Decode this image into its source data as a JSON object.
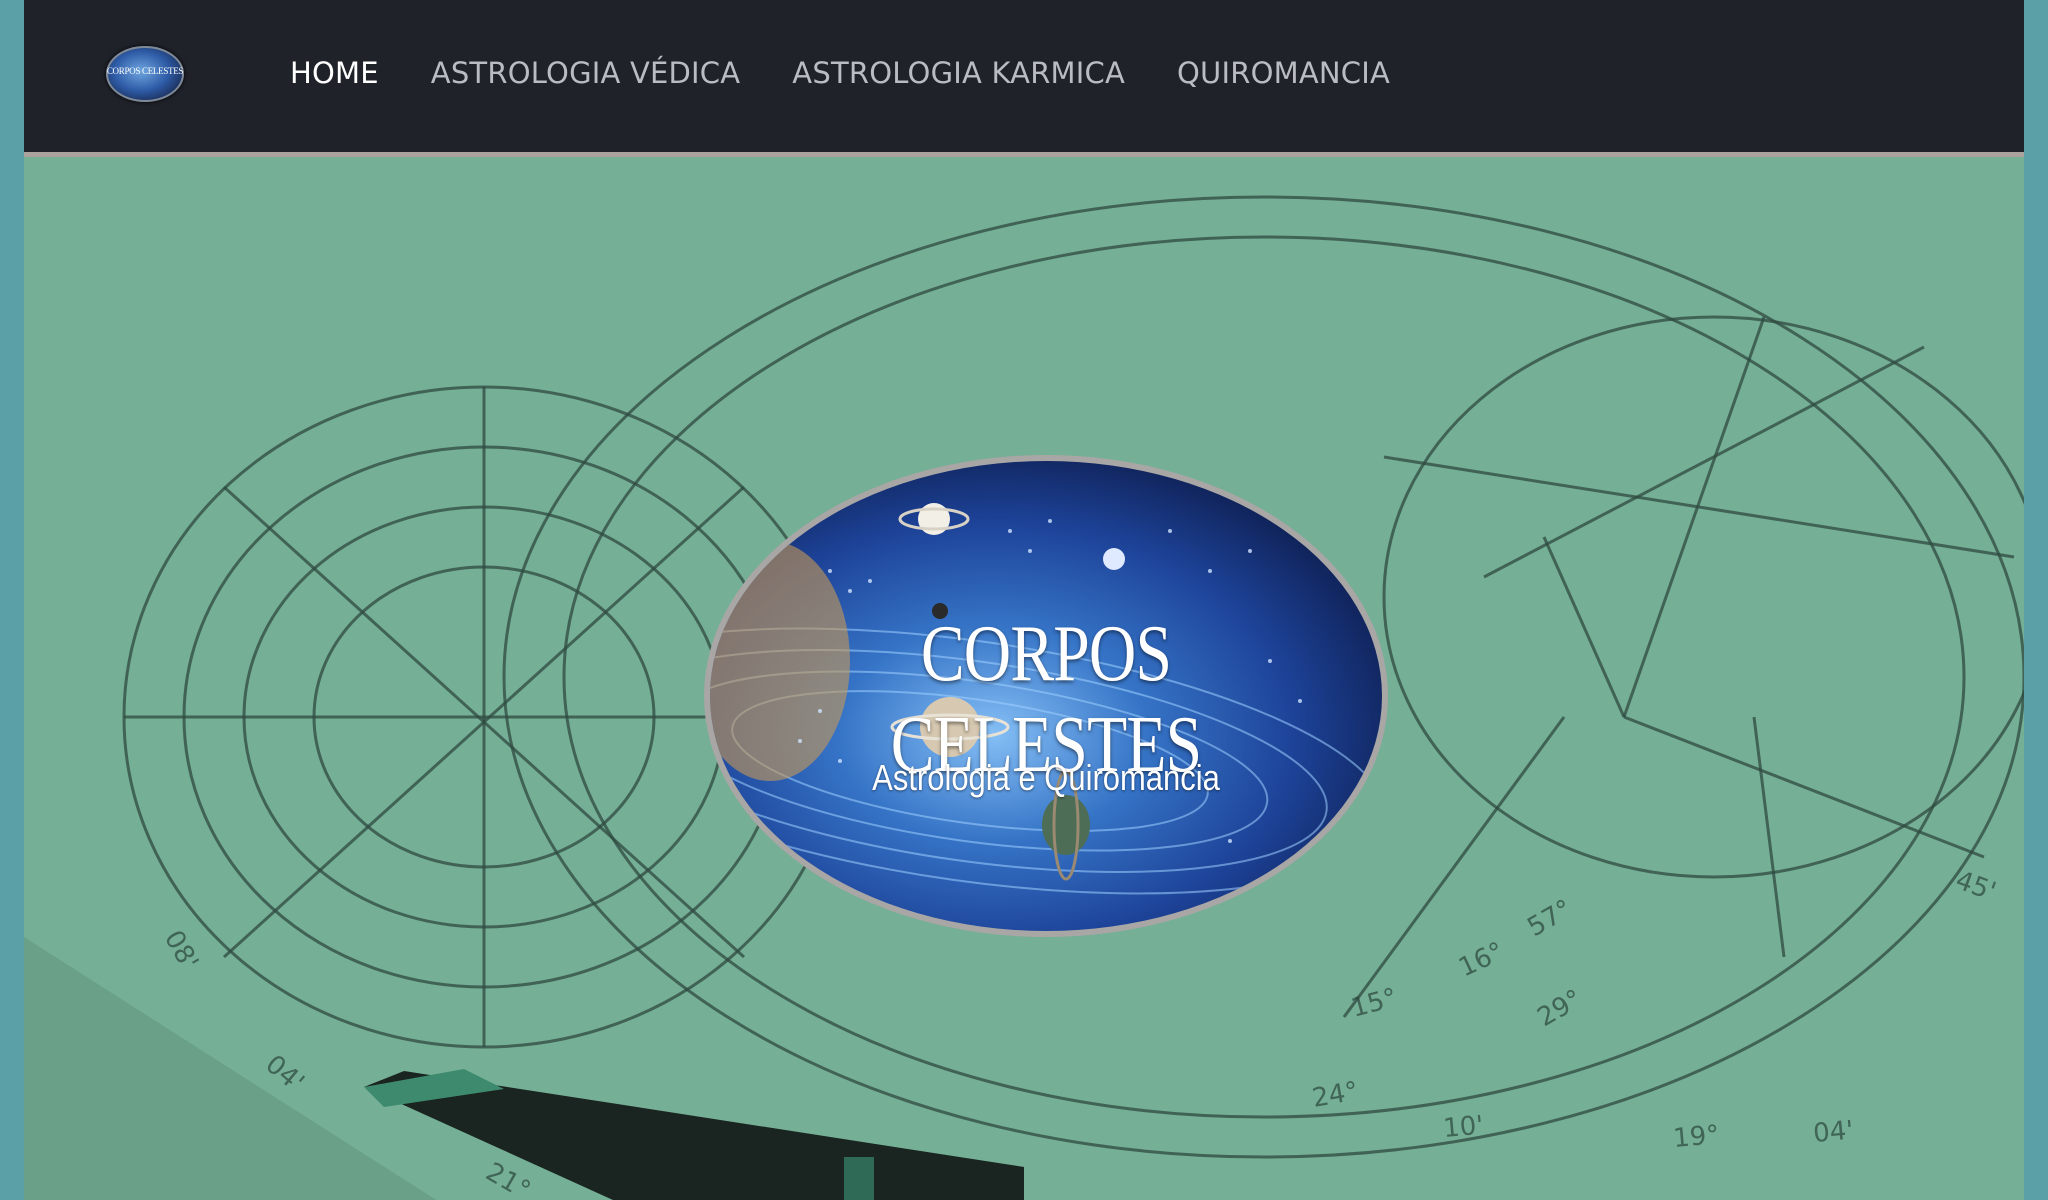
{
  "brand": {
    "logo_text": "CORPOS CELESTES"
  },
  "nav": {
    "items": [
      {
        "label": "HOME",
        "active": true
      },
      {
        "label": "ASTROLOGIA VÉDICA",
        "active": false
      },
      {
        "label": "ASTROLOGIA KARMICA",
        "active": false
      },
      {
        "label": "QUIROMANCIA",
        "active": false
      }
    ]
  },
  "hero": {
    "title": "CORPOS CELESTES",
    "subtitle": "Astrologia e Quiromancia"
  },
  "colors": {
    "navbar": "#1f2229",
    "hero_tint": "#73ae95",
    "page_border": "#5aa0a6"
  }
}
